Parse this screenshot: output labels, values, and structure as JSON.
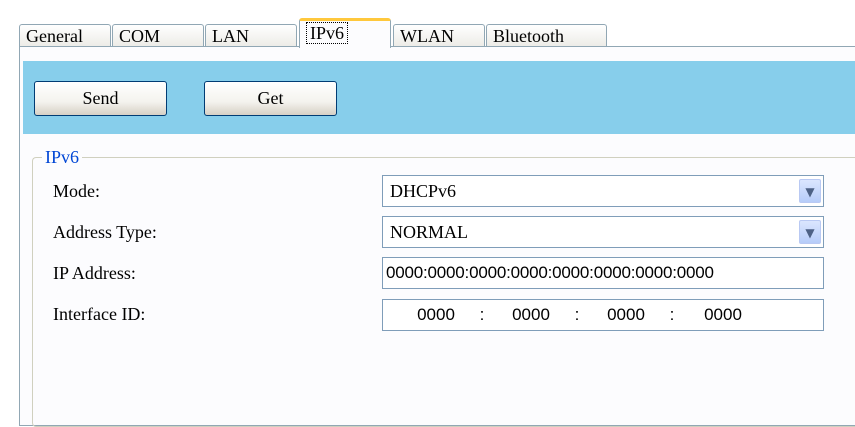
{
  "tabs": [
    {
      "label": "General",
      "active": false
    },
    {
      "label": "COM",
      "active": false
    },
    {
      "label": "LAN",
      "active": false
    },
    {
      "label": "IPv6",
      "active": true
    },
    {
      "label": "WLAN",
      "active": false
    },
    {
      "label": "Bluetooth",
      "active": false
    }
  ],
  "toolbar": {
    "send_label": "Send",
    "get_label": "Get",
    "background_color": "#87ceeb"
  },
  "group": {
    "title": "IPv6",
    "title_color": "#0046d5"
  },
  "fields": {
    "mode": {
      "label": "Mode:",
      "value": "DHCPv6"
    },
    "address_type": {
      "label": "Address Type:",
      "value": "NORMAL"
    },
    "ip_address": {
      "label": "IP Address:",
      "value": "0000:0000:0000:0000:0000:0000:0000:0000"
    },
    "interface_id": {
      "label": "Interface ID:",
      "segments": [
        "0000",
        "0000",
        "0000",
        "0000"
      ],
      "separator": ":"
    }
  },
  "icons": {
    "dropdown_arrow": "chevron-down-icon"
  }
}
